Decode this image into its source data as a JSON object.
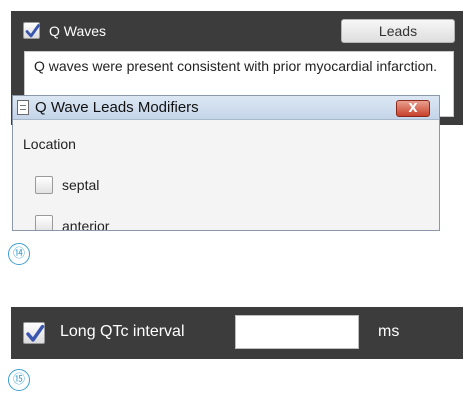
{
  "q_waves_panel": {
    "checkbox_label": "Q Waves",
    "checked": true,
    "leads_button": "Leads",
    "text": "Q waves were present consistent with prior myocardial infarction."
  },
  "modifier_dialog": {
    "title": "Q Wave Leads Modifiers",
    "close_symbol": "X",
    "location_label": "Location",
    "options": [
      {
        "label": "septal",
        "checked": false
      },
      {
        "label": "anterior",
        "checked": false
      }
    ]
  },
  "step_numbers": [
    "⑭",
    "⑮"
  ],
  "long_qtc_panel": {
    "checkbox_label": "Long QTc interval",
    "checked": true,
    "input_value": "",
    "unit": "ms"
  },
  "colors": {
    "panel_background": "#3c3c3c",
    "checkmark": "#3a55b0",
    "step_number": "#3f9fd0",
    "close_button": "#c7412b"
  }
}
